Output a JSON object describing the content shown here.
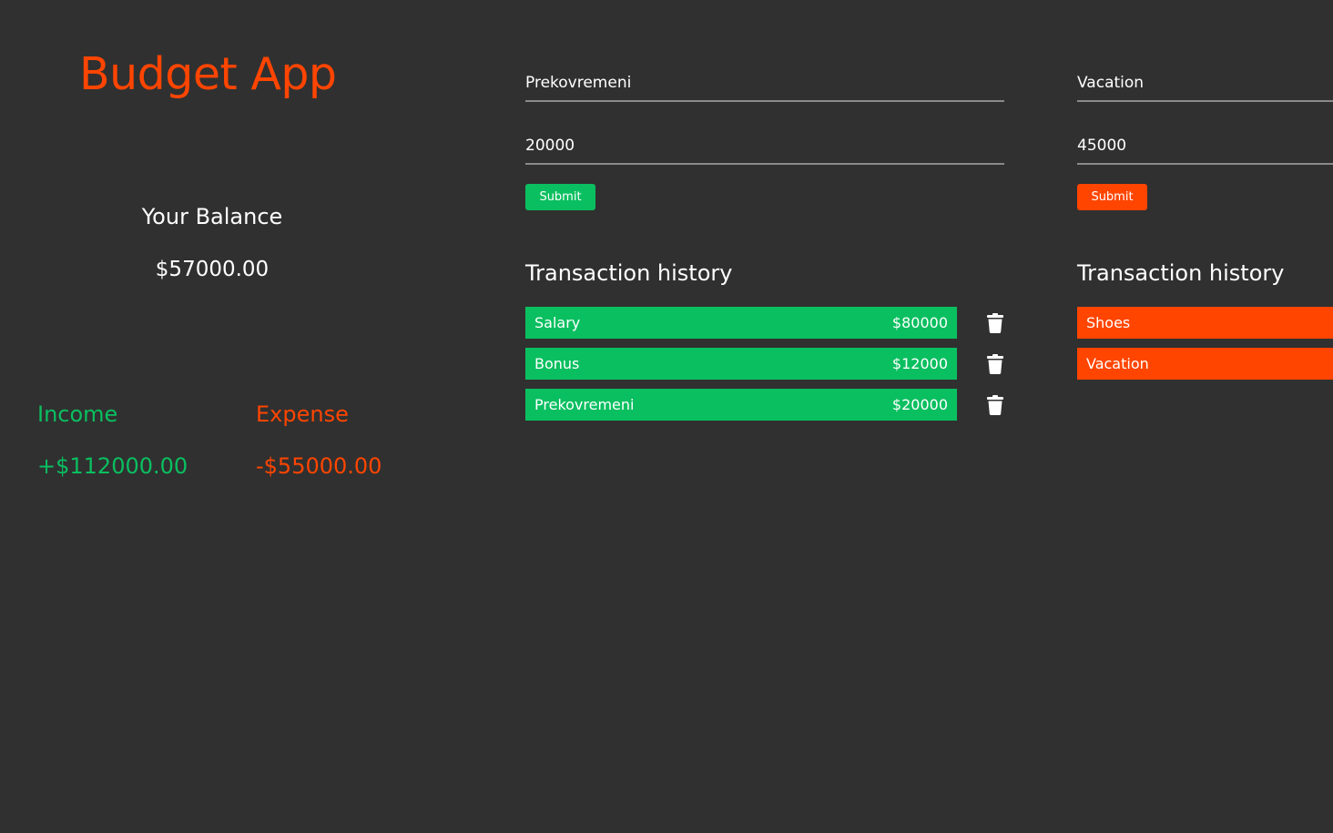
{
  "app": {
    "title": "Budget App"
  },
  "balance": {
    "label": "Your Balance",
    "value": "$57000.00"
  },
  "summary": {
    "income_label": "Income",
    "income_value": "+$112000.00",
    "expense_label": "Expense",
    "expense_value": "-$55000.00"
  },
  "income_form": {
    "name_value": "Prekovremeni",
    "amount_value": "20000",
    "submit_label": "Submit",
    "history_title": "Transaction history",
    "transactions": [
      {
        "name": "Salary",
        "amount": "$80000"
      },
      {
        "name": "Bonus",
        "amount": "$12000"
      },
      {
        "name": "Prekovremeni",
        "amount": "$20000"
      }
    ]
  },
  "expense_form": {
    "name_value": "Vacation",
    "amount_value": "45000",
    "submit_label": "Submit",
    "history_title": "Transaction history",
    "transactions": [
      {
        "name": "Shoes"
      },
      {
        "name": "Vacation"
      }
    ]
  },
  "colors": {
    "background": "#303030",
    "income": "#0abf60",
    "expense": "#ff4500",
    "text": "#ffffff"
  },
  "icons": {
    "delete": "trash-icon"
  }
}
